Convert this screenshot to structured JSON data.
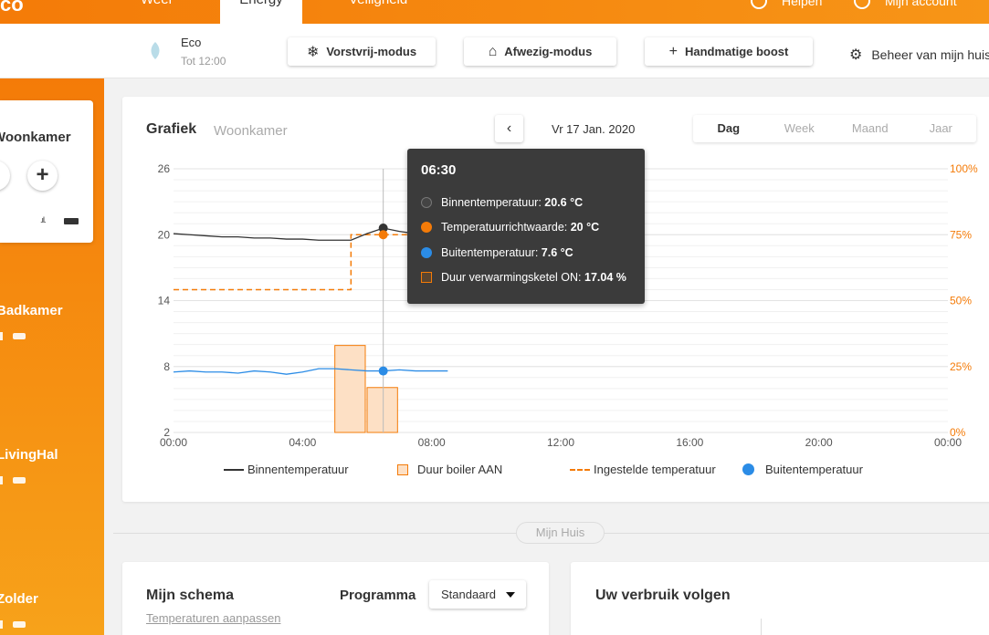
{
  "nav": {
    "logo": "co",
    "tabs": [
      {
        "label": "Weer"
      },
      {
        "label": "Energy"
      },
      {
        "label": "Veiligheid"
      }
    ],
    "help": "Helpen",
    "account": "Mijn account"
  },
  "eco": {
    "title": "Eco",
    "subtitle": "Tot 12:00"
  },
  "modes": {
    "vorstvrij": "Vorstvrij-modus",
    "afwezig": "Afwezig-modus",
    "boost": "Handmatige boost",
    "beheer": "Beheer van mijn huis"
  },
  "left": {
    "card_room": "Woonkamer",
    "rooms": [
      "Badkamer",
      "LivingHal",
      "Zolder"
    ]
  },
  "chart_card": {
    "title": "Grafiek",
    "room": "Woonkamer",
    "date": "Vr 17 Jan. 2020",
    "periods": [
      "Dag",
      "Week",
      "Maand",
      "Jaar"
    ],
    "active_period": "Dag"
  },
  "tooltip": {
    "time": "06:30",
    "rows": [
      {
        "label": "Binnentemperatuur: ",
        "value": "20.6 °C"
      },
      {
        "label": "Temperatuurrichtwaarde: ",
        "value": "20 °C"
      },
      {
        "label": "Buitentemperatuur: ",
        "value": "7.6 °C"
      },
      {
        "label": "Duur verwarmingsketel ON: ",
        "value": "17.04 %"
      }
    ]
  },
  "legend": {
    "binnen": "Binnentemperatuur",
    "boiler": "Duur boiler AAN",
    "ingesteld": "Ingestelde temperatuur",
    "buiten": "Buitentemperatuur"
  },
  "colors": {
    "accent": "#f47b08",
    "indoor": "#333333",
    "outdoor": "#2b8ce6",
    "boiler_fill": "#fde0c5"
  },
  "chart_data": {
    "type": "line",
    "x_ticks": [
      "00:00",
      "04:00",
      "08:00",
      "12:00",
      "16:00",
      "20:00",
      "00:00"
    ],
    "y_left_ticks": [
      2,
      8,
      14,
      20,
      26
    ],
    "y_right_ticks": [
      "0%",
      "25%",
      "50%",
      "75%",
      "100%"
    ],
    "ylim": [
      2,
      26
    ],
    "x_hours": [
      0,
      24
    ],
    "series": [
      {
        "name": "Binnentemperatuur",
        "x": [
          0,
          0.5,
          1,
          1.5,
          2,
          2.5,
          3,
          3.5,
          4,
          4.5,
          5,
          5.5,
          6,
          6.5,
          7,
          7.5
        ],
        "values": [
          20.1,
          20.0,
          19.9,
          19.8,
          19.8,
          19.7,
          19.7,
          19.6,
          19.6,
          19.5,
          19.5,
          19.5,
          20.1,
          20.6,
          20.3,
          20.1
        ]
      },
      {
        "name": "Ingestelde temperatuur",
        "x": [
          0,
          5.5,
          5.5,
          7.5
        ],
        "values": [
          15,
          15,
          20,
          20
        ]
      },
      {
        "name": "Buitentemperatuur",
        "x": [
          0,
          0.5,
          1,
          1.5,
          2,
          2.5,
          3,
          3.5,
          4,
          4.5,
          5,
          5.5,
          6,
          6.5,
          7,
          7.5,
          8,
          8.5
        ],
        "values": [
          7.5,
          7.6,
          7.5,
          7.5,
          7.4,
          7.6,
          7.5,
          7.3,
          7.5,
          7.8,
          7.8,
          7.7,
          7.6,
          7.6,
          7.7,
          7.6,
          7.6,
          7.6
        ]
      },
      {
        "name": "Duur boiler AAN",
        "bars": [
          {
            "start": 5,
            "end": 6,
            "percent": 33
          },
          {
            "start": 6,
            "end": 7,
            "percent": 17.04
          }
        ]
      }
    ],
    "hover_hour": 6.5
  },
  "divider": "Mijn Huis",
  "schema": {
    "title": "Mijn schema",
    "link": "Temperaturen aanpassen",
    "program_label": "Programma",
    "program_value": "Standaard"
  },
  "verbruik": {
    "title": "Uw verbruik volgen"
  }
}
